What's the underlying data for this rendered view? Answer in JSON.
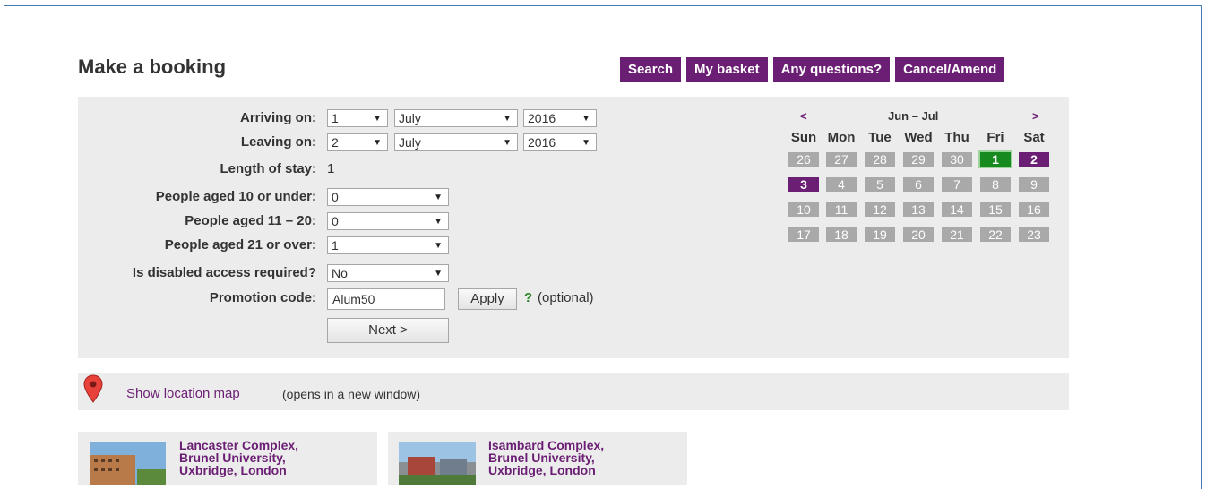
{
  "page": {
    "title": "Make a booking"
  },
  "nav": [
    {
      "label": "Search"
    },
    {
      "label": "My basket"
    },
    {
      "label": "Any questions?"
    },
    {
      "label": "Cancel/Amend"
    }
  ],
  "form": {
    "arriving": {
      "label": "Arriving on:",
      "day": "1",
      "month": "July",
      "year": "2016"
    },
    "leaving": {
      "label": "Leaving on:",
      "day": "2",
      "month": "July",
      "year": "2016"
    },
    "stay": {
      "label": "Length of stay:",
      "value": "1"
    },
    "under10": {
      "label": "People aged 10 or under:",
      "value": "0"
    },
    "age11to20": {
      "label": "People aged 11 – 20:",
      "value": "0"
    },
    "over21": {
      "label": "People aged 21 or over:",
      "value": "1"
    },
    "disabled": {
      "label": "Is disabled access required?",
      "value": "No"
    },
    "promo": {
      "label": "Promotion code:",
      "value": "Alum50",
      "apply_label": "Apply",
      "help": "?",
      "optional": "(optional)"
    },
    "next_label": "Next >"
  },
  "calendar": {
    "prev": "<",
    "next": ">",
    "title": "Jun – Jul",
    "days_of_week": [
      "Sun",
      "Mon",
      "Tue",
      "Wed",
      "Thu",
      "Fri",
      "Sat"
    ],
    "weeks": [
      [
        "26",
        "27",
        "28",
        "29",
        "30",
        "1",
        "2"
      ],
      [
        "3",
        "4",
        "5",
        "6",
        "7",
        "8",
        "9"
      ],
      [
        "10",
        "11",
        "12",
        "13",
        "14",
        "15",
        "16"
      ],
      [
        "17",
        "18",
        "19",
        "20",
        "21",
        "22",
        "23"
      ]
    ],
    "selected_start": "1",
    "selected_range": [
      "2",
      "3"
    ],
    "colors": {
      "grey": "#a9a9a9",
      "start": "#168a1e",
      "range": "#6b1f74"
    }
  },
  "location": {
    "link_label": "Show location map",
    "note": "(opens in a new window)",
    "icon": "map-pin-icon"
  },
  "properties": [
    {
      "title_lines": [
        "Lancaster Complex,",
        "Brunel University,",
        "Uxbridge, London"
      ]
    },
    {
      "title_lines": [
        "Isambard Complex,",
        "Brunel University,",
        "Uxbridge, London"
      ]
    }
  ],
  "colors": {
    "accent": "#6b1f74",
    "panel": "#ececec",
    "frame": "#4a7ab5"
  }
}
